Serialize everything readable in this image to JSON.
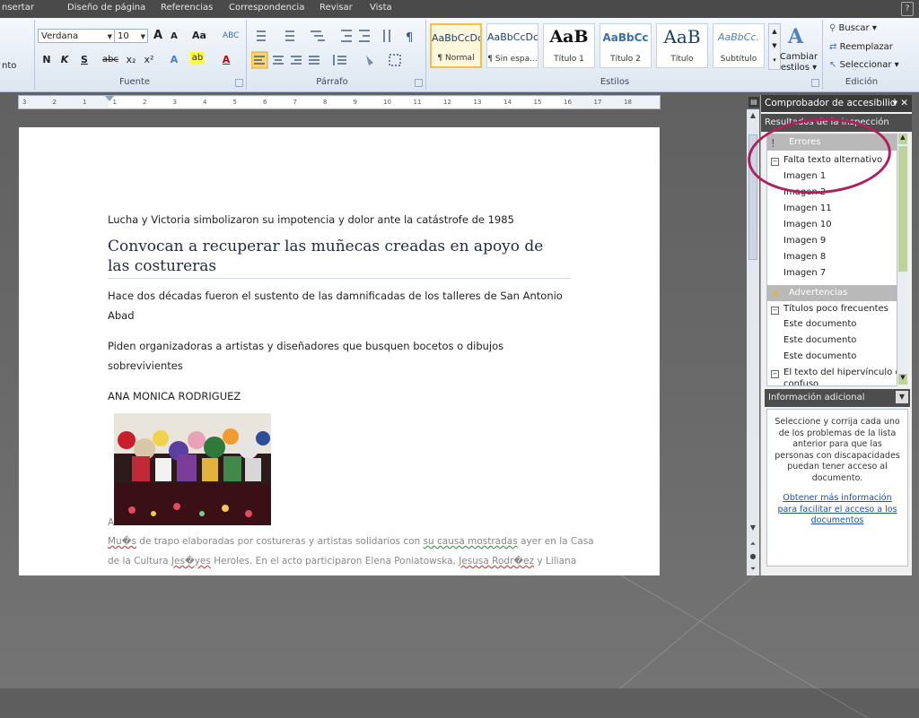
{
  "menu": {
    "tabs": [
      "nsertar",
      "Diseño de página",
      "Referencias",
      "Correspondencia",
      "Revisar",
      "Vista"
    ],
    "help_icon": "help-icon"
  },
  "ribbon": {
    "font": {
      "name": "Verdana",
      "size": "10",
      "group_label": "Fuente",
      "left_stub": "nto",
      "buttons": {
        "grow": "A",
        "shrink": "A",
        "case": "Aa",
        "clear": "ABC",
        "bold": "N",
        "italic": "K",
        "underline": "S",
        "strike": "abc",
        "sub": "x₂",
        "sup": "x²",
        "effects": "A",
        "highlight": "ab",
        "color": "A"
      }
    },
    "paragraph": {
      "group_label": "Párrafo"
    },
    "styles": {
      "group_label": "Estilos",
      "items": [
        {
          "sample": "AaBbCcDc",
          "name": "¶ Normal",
          "selected": true
        },
        {
          "sample": "AaBbCcDc",
          "name": "¶ Sin espa..."
        },
        {
          "sample": "AaB",
          "name": "Título 1"
        },
        {
          "sample": "AaBbCc",
          "name": "Título 2"
        },
        {
          "sample": "AaB",
          "name": "Título"
        },
        {
          "sample": "AaBbCc.",
          "name": "Subtítulo"
        }
      ],
      "change_label": [
        "Cambiar",
        "estilos"
      ]
    },
    "edit": {
      "group_label": "Edición",
      "buscar": "Buscar",
      "reemplazar": "Reemplazar",
      "seleccionar": "Seleccionar"
    }
  },
  "ruler": {
    "ticks": [
      "3",
      "2",
      "1",
      "1",
      "2",
      "3",
      "4",
      "5",
      "6",
      "7",
      "8",
      "9",
      "10",
      "11",
      "12",
      "13",
      "14",
      "15",
      "16",
      "17",
      "18"
    ]
  },
  "document": {
    "kicker": "Lucha y Victoria simbolizaron su impotencia y dolor ante la catástrofe de 1985",
    "heading": "Convocan a recuperar las muñecas creadas en apoyo de las costureras",
    "sub1": "Hace dos décadas fueron el sustento de las damnificadas de los talleres de San Antonio Abad",
    "sub2": "Piden organizadoras a artistas y diseñadores que busquen bocetos o dibujos sobrevivientes",
    "author": "ANA MONICA RODRIGUEZ",
    "caption_stub": "A",
    "caption1_a": "Mu�s",
    "caption1_b": " de trapo elaboradas por costureras y artistas solidarios con ",
    "caption1_c": "su causa mostradas",
    "caption1_d": " ayer en la Casa",
    "caption2_a": "de la Cultura ",
    "caption2_b": "Jes�yes",
    "caption2_c": " Heroles. En el acto participaron Elena Poniatowska, ",
    "caption2_d": "Jesusa Rodr�ez",
    "caption2_e": " y Liliana"
  },
  "pane": {
    "title": "Comprobador de accesibilid",
    "results_title": "Resultados de la inspección",
    "errors_label": "Errores",
    "error_group": "Falta texto alternativo",
    "error_items": [
      "Imagen 1",
      "Imagen 2",
      "Imagen 11",
      "Imagen 10",
      "Imagen 9",
      "Imagen 8",
      "Imagen 7"
    ],
    "warnings_label": "Advertencias",
    "warning_group": "Títulos poco frecuentes",
    "warning_items": [
      "Este documento",
      "Este documento",
      "Este documento"
    ],
    "warning_group2": "El texto del hipervínculo es",
    "warning_group2_cont": "confuso",
    "info_title": "Información adicional",
    "info_text": "Seleccione y corrija cada uno de los problemas de la lista anterior para que las personas con discapacidades puedan tener acceso al documento.",
    "info_link": "Obtener más información para facilitar el acceso a los documentos"
  },
  "colors": {
    "highlight_circle": "#b0205c",
    "ribbon_active": "#fbd66c",
    "link": "#1f4ea8"
  }
}
